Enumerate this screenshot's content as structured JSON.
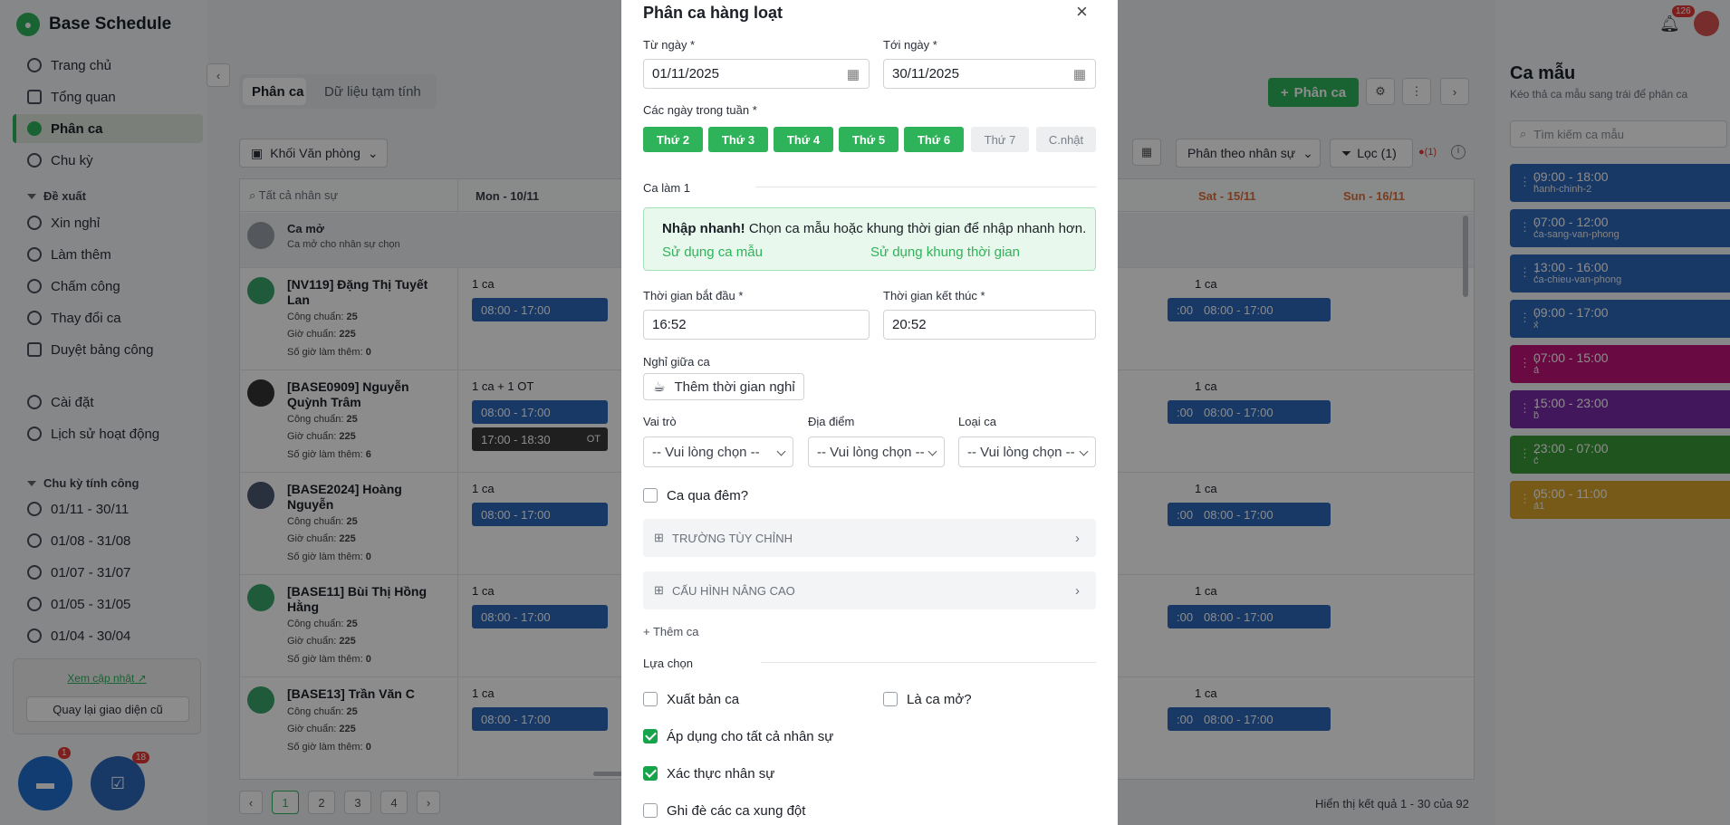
{
  "app": {
    "title": "Base Schedule",
    "notif_count": "126"
  },
  "sidebar": {
    "nav": [
      {
        "label": "Trang chủ"
      },
      {
        "label": "Tổng quan"
      },
      {
        "label": "Phân ca"
      },
      {
        "label": "Chu kỳ"
      }
    ],
    "proposal_group": "Đề xuất",
    "proposals": [
      {
        "label": "Xin nghỉ"
      },
      {
        "label": "Làm thêm"
      },
      {
        "label": "Chấm công"
      },
      {
        "label": "Thay đổi ca"
      },
      {
        "label": "Duyệt bảng công"
      }
    ],
    "settings": "Cài đặt",
    "history": "Lịch sử hoạt động",
    "cycle_group": "Chu kỳ tính công",
    "cycles": [
      {
        "label": "01/11 - 30/11"
      },
      {
        "label": "01/08 - 31/08"
      },
      {
        "label": "01/07 - 31/07"
      },
      {
        "label": "01/05 - 31/05"
      },
      {
        "label": "01/04 - 30/04"
      }
    ],
    "update_link": "Xem cập nhật",
    "old_ui_button": "Quay lại giao diện cũ"
  },
  "main": {
    "tabs": [
      {
        "label": "Phân ca"
      },
      {
        "label": "Dữ liệu tạm tính"
      }
    ],
    "add_button": "Phân ca",
    "office_filter": "Khối Văn phòng",
    "assign_mode": "Phân theo nhân sự",
    "filter_button": "Lọc (1)",
    "error_count": "(1)",
    "search_placeholder": "Tất cả nhân sự",
    "day_headers": [
      {
        "label": "Mon - 10/11"
      },
      {
        "label": "Sat - 15/11"
      },
      {
        "label": "Sun - 16/11"
      }
    ],
    "open_shift": {
      "title": "Ca mở",
      "sub": "Ca mở cho nhân sự chọn"
    },
    "employees": [
      {
        "name": "[NV119] Đặng Thị Tuyết Lan",
        "cong": "25",
        "gio": "225",
        "ot": "0",
        "mon_count": "1 ca",
        "mon_shift": "08:00 - 17:00",
        "sat_count": "1 ca",
        "sat_shift": "08:00 - 17:00",
        "r_shift": ":00"
      },
      {
        "name": "[BASE0909] Nguyễn Quỳnh Trâm",
        "cong": "25",
        "gio": "225",
        "ot": "6",
        "mon_count": "1 ca + 1 OT",
        "mon_shift": "08:00 - 17:00",
        "mon_ot": "17:00 - 18:30",
        "ot_tag": "OT",
        "sat_count": "1 ca",
        "sat_shift": "08:00 - 17:00",
        "r_shift": ":00"
      },
      {
        "name": "[BASE2024] Hoàng Nguyễn",
        "cong": "25",
        "gio": "225",
        "ot": "0",
        "mon_count": "1 ca",
        "mon_shift": "08:00 - 17:00",
        "sat_count": "1 ca",
        "sat_shift": "08:00 - 17:00",
        "r_shift": ":00"
      },
      {
        "name": "[BASE11] Bùi Thị Hồng Hằng",
        "cong": "25",
        "gio": "225",
        "ot": "0",
        "mon_count": "1 ca",
        "mon_shift": "08:00 - 17:00",
        "sat_count": "1 ca",
        "sat_shift": "08:00 - 17:00",
        "r_shift": ":00"
      },
      {
        "name": "[BASE13] Trần Văn C",
        "cong": "25",
        "gio": "225",
        "ot": "0",
        "mon_count": "1 ca",
        "mon_shift": "08:00 - 17:00",
        "sat_count": "1 ca",
        "sat_shift": "08:00 - 17:00",
        "r_shift": ":00"
      }
    ],
    "stat_labels": {
      "cong": "Công chuẩn:",
      "gio": "Giờ chuẩn:",
      "ot": "Số giờ làm thêm:"
    },
    "pagination": {
      "pages": [
        "1",
        "2",
        "3",
        "4"
      ],
      "summary": "Hiển thị kết quả 1 - 30 của 92"
    }
  },
  "right_panel": {
    "title": "Ca mẫu",
    "subtitle": "Kéo thả ca mẫu sang trái để phân ca",
    "search_placeholder": "Tìm kiếm ca mẫu",
    "templates": [
      {
        "time": "09:00 - 18:00",
        "code": "hanh-chinh-2",
        "color": "#2d66b8"
      },
      {
        "time": "07:00 - 12:00",
        "code": "ca-sang-van-phong",
        "color": "#2d66b8"
      },
      {
        "time": "13:00 - 16:00",
        "code": "ca-chieu-van-phong",
        "color": "#2d66b8"
      },
      {
        "time": "09:00 - 17:00",
        "code": "x",
        "color": "#2d66b8"
      },
      {
        "time": "07:00 - 15:00",
        "code": "a",
        "color": "#c2137a"
      },
      {
        "time": "15:00 - 23:00",
        "code": "b",
        "color": "#7a2aa8"
      },
      {
        "time": "23:00 - 07:00",
        "code": "c",
        "color": "#3a9a3a"
      },
      {
        "time": "05:00 - 11:00",
        "code": "a1",
        "color": "#d9a42a"
      }
    ]
  },
  "fabs": {
    "chat_badge": "1",
    "task_badge": "18"
  },
  "modal": {
    "title": "Phân ca hàng loạt",
    "from_label": "Từ ngày *",
    "from_value": "01/11/2025",
    "to_label": "Tới ngày *",
    "to_value": "30/11/2025",
    "weekdays_label": "Các ngày trong tuần *",
    "weekdays": [
      {
        "label": "Thứ 2",
        "on": true
      },
      {
        "label": "Thứ 3",
        "on": true
      },
      {
        "label": "Thứ 4",
        "on": true
      },
      {
        "label": "Thứ 5",
        "on": true
      },
      {
        "label": "Thứ 6",
        "on": true
      },
      {
        "label": "Thứ 7",
        "on": false
      },
      {
        "label": "C.nhật",
        "on": false
      }
    ],
    "shift_section": "Ca làm 1",
    "quick_bold": "Nhập nhanh!",
    "quick_text": " Chọn ca mẫu hoặc khung thời gian để nhập nhanh hơn.",
    "use_template": "Sử dụng ca mẫu",
    "use_timeframe": "Sử dụng khung thời gian",
    "start_label": "Thời gian bắt đầu *",
    "start_value": "16:52",
    "end_label": "Thời gian kết thúc *",
    "end_value": "20:52",
    "break_label": "Nghỉ giữa ca",
    "break_button": "Thêm thời gian nghỉ",
    "role_label": "Vai trò",
    "location_label": "Địa điểm",
    "type_label": "Loại ca",
    "select_placeholder": "-- Vui lòng chọn --",
    "overnight": "Ca qua đêm?",
    "custom_fields": "TRƯỜNG TÙY CHỈNH",
    "advanced": "CẤU HÌNH NÂNG CAO",
    "add_shift": "+ Thêm ca",
    "options_label": "Lựa chọn",
    "opt_publish": "Xuất bản ca",
    "opt_open": "Là ca mở?",
    "opt_apply_all": "Áp dụng cho tất cả nhân sự",
    "opt_verify": "Xác thực nhân sự",
    "opt_override": "Ghi đè các ca xung đột"
  }
}
